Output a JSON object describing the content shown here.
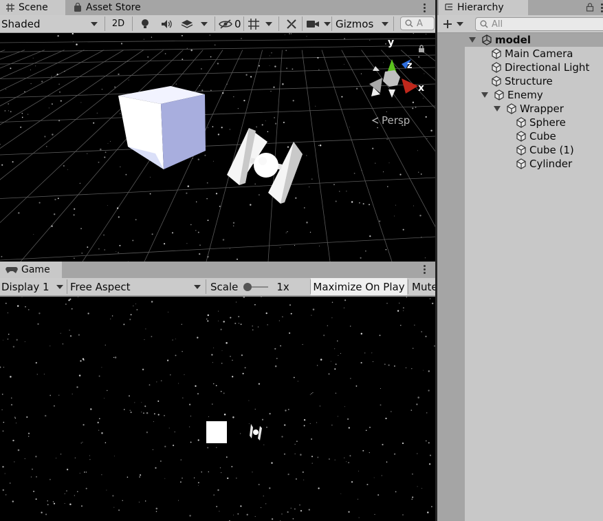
{
  "scene_tabs": [
    {
      "label": "Scene",
      "icon": "grid-icon",
      "active": true
    },
    {
      "label": "Asset Store",
      "icon": "bag-icon",
      "active": false
    }
  ],
  "scene_toolbar": {
    "draw_mode": "Shaded",
    "mode_2d": "2D",
    "hidden_count": "0",
    "gizmos": "Gizmos",
    "search_placeholder": "A"
  },
  "scene_view": {
    "persp_label": "Persp",
    "axis_x": "x",
    "axis_y": "y",
    "axis_z": "z"
  },
  "game_tab": {
    "label": "Game",
    "icon": "gamepad-icon"
  },
  "game_toolbar": {
    "display": "Display 1",
    "aspect": "Free Aspect",
    "scale_label": "Scale",
    "scale_value": "1x",
    "maximize": "Maximize On Play",
    "mute": "Mute"
  },
  "hierarchy": {
    "title": "Hierarchy",
    "search_placeholder": "All",
    "root": "model",
    "items": [
      {
        "label": "Main Camera"
      },
      {
        "label": "Directional Light"
      },
      {
        "label": "Structure"
      },
      {
        "label": "Enemy"
      },
      {
        "label": "Wrapper"
      },
      {
        "label": "Sphere"
      },
      {
        "label": "Cube"
      },
      {
        "label": "Cube (1)"
      },
      {
        "label": "Cylinder"
      }
    ]
  },
  "colors": {
    "tab_bg": "#a5a5a5",
    "toolbar_bg": "#cbcbcb",
    "hierarchy_bg": "#c8c8c8",
    "axis_x": "#c0281c",
    "axis_y": "#5cc21e",
    "axis_z": "#2e6fe0"
  }
}
